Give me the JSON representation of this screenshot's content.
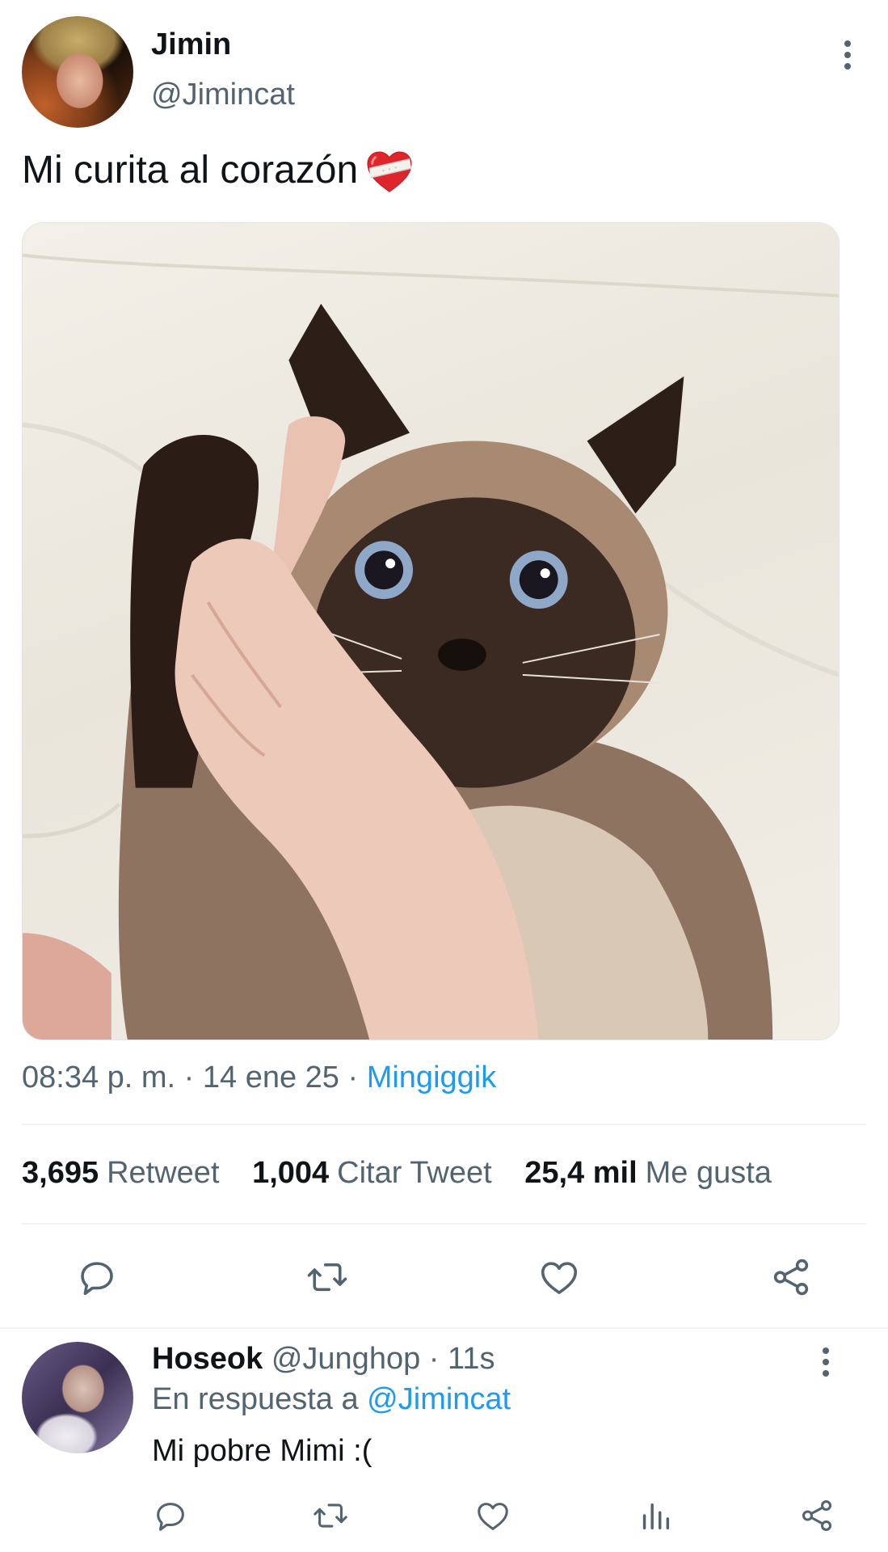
{
  "tweet": {
    "author_name": "Jimin",
    "author_handle": "@Jimincat",
    "text": "Mi curita al corazón",
    "emoji": "mending-heart-emoji",
    "image_description_icon": "cat-photo",
    "timestamp": "08:34 p. m. · 14 ene 25 · ",
    "source": "Mingiggik",
    "stats": [
      {
        "count": "3,695",
        "label": "Retweet"
      },
      {
        "count": "1,004",
        "label": "Citar Tweet"
      },
      {
        "count": "25,4 mil",
        "label": "Me gusta"
      }
    ],
    "actions": [
      "reply-icon",
      "retweet-icon",
      "like-icon",
      "share-icon"
    ]
  },
  "reply": {
    "author_name": "Hoseok",
    "author_handle": "@Junghop",
    "time": " · 11s",
    "in_reply_to_prefix": "En respuesta a ",
    "in_reply_to_handle": "@Jimincat",
    "text": "Mi pobre Mimi :(",
    "actions": [
      "reply-icon",
      "retweet-icon",
      "like-icon",
      "analytics-icon",
      "share-icon"
    ]
  },
  "colors": {
    "text": "#0f1419",
    "muted": "#536471",
    "link": "#1d9bf0",
    "divider": "#eff3f4"
  }
}
